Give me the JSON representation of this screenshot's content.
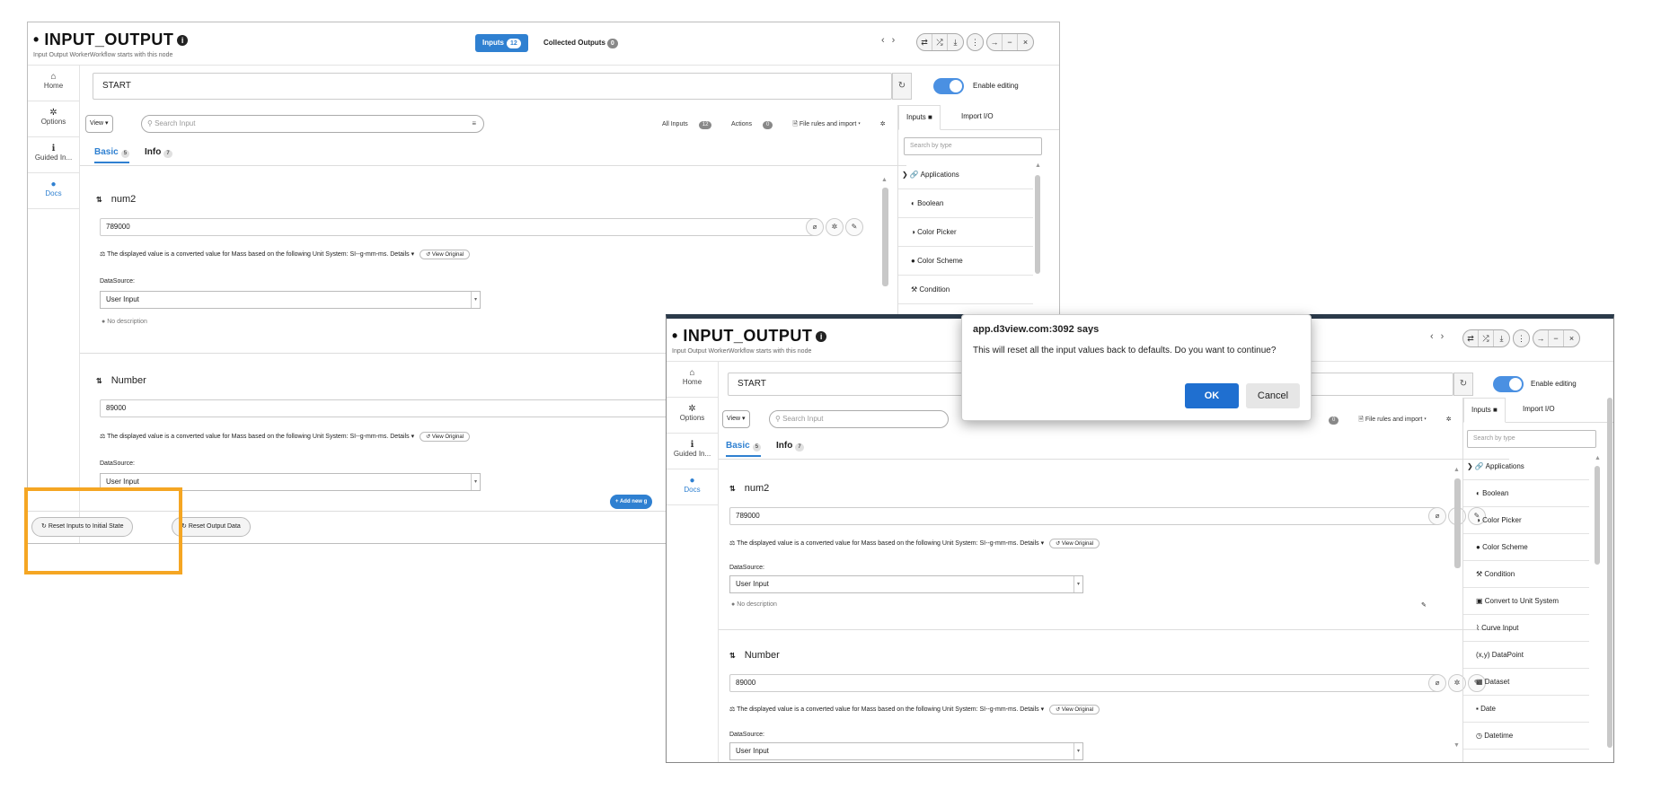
{
  "node": {
    "title": "INPUT_OUTPUT",
    "subtitle": "Input Output WorkerWorkflow starts with this node",
    "tab_inputs": "Inputs",
    "tab_inputs_count": "12",
    "tab_outputs": "Collected Outputs",
    "tab_outputs_count": "0",
    "nav_prev": "‹",
    "nav_next": "›"
  },
  "sidebar": {
    "items": [
      {
        "label": "Home",
        "icon": "home-icon"
      },
      {
        "label": "Options",
        "icon": "gear-icon"
      },
      {
        "label": "Guided In...",
        "icon": "info-icon"
      },
      {
        "label": "Docs",
        "icon": "docs-icon"
      }
    ]
  },
  "start": {
    "value": "START",
    "enable_editing": "Enable editing"
  },
  "toolbar": {
    "view": "View ▾",
    "search_placeholder": "Search Input",
    "all_inputs": "All Inputs",
    "all_inputs_count": "12",
    "actions": "Actions",
    "actions_count": "0",
    "file_rules": "File rules and import ▾"
  },
  "subtabs": {
    "basic": "Basic",
    "basic_count": "5",
    "info": "Info",
    "info_count": "7"
  },
  "inputs": [
    {
      "name": "num2",
      "value": "789000",
      "note": "The displayed value is a converted value for Mass based on the following Unit System: SI--g-mm-ms.",
      "details": "Details ▾",
      "view_original": "View Original",
      "datasource_label": "DataSource:",
      "datasource_value": "User Input",
      "description": "No description"
    },
    {
      "name": "Number",
      "value": "89000",
      "note": "The displayed value is a converted value for Mass based on the following Unit System: SI--g-mm-ms.",
      "details": "Details ▾",
      "view_original": "View Original",
      "datasource_label": "DataSource:",
      "datasource_value": "User Input"
    }
  ],
  "right_panel": {
    "tab_inputs": "Inputs",
    "tab_import": "Import I/O",
    "search_placeholder": "Search by type",
    "types": [
      "Applications",
      "Boolean",
      "Color Picker",
      "Color Scheme",
      "Condition",
      "Convert to Unit System",
      "Curve Input",
      "DataPoint",
      "Dataset",
      "Date",
      "Datetime"
    ]
  },
  "bottom": {
    "reset_inputs": "Reset Inputs to Initial State",
    "reset_output": "Reset Output Data",
    "add_new": "+ Add new g"
  },
  "dialog": {
    "title": "app.d3view.com:3092 says",
    "message": "This will reset all the input values back to defaults. Do you want to continue?",
    "ok": "OK",
    "cancel": "Cancel"
  },
  "colors": {
    "accent": "#2f80d1",
    "highlight": "#f5a623",
    "ok_button": "#1f6fd0"
  }
}
